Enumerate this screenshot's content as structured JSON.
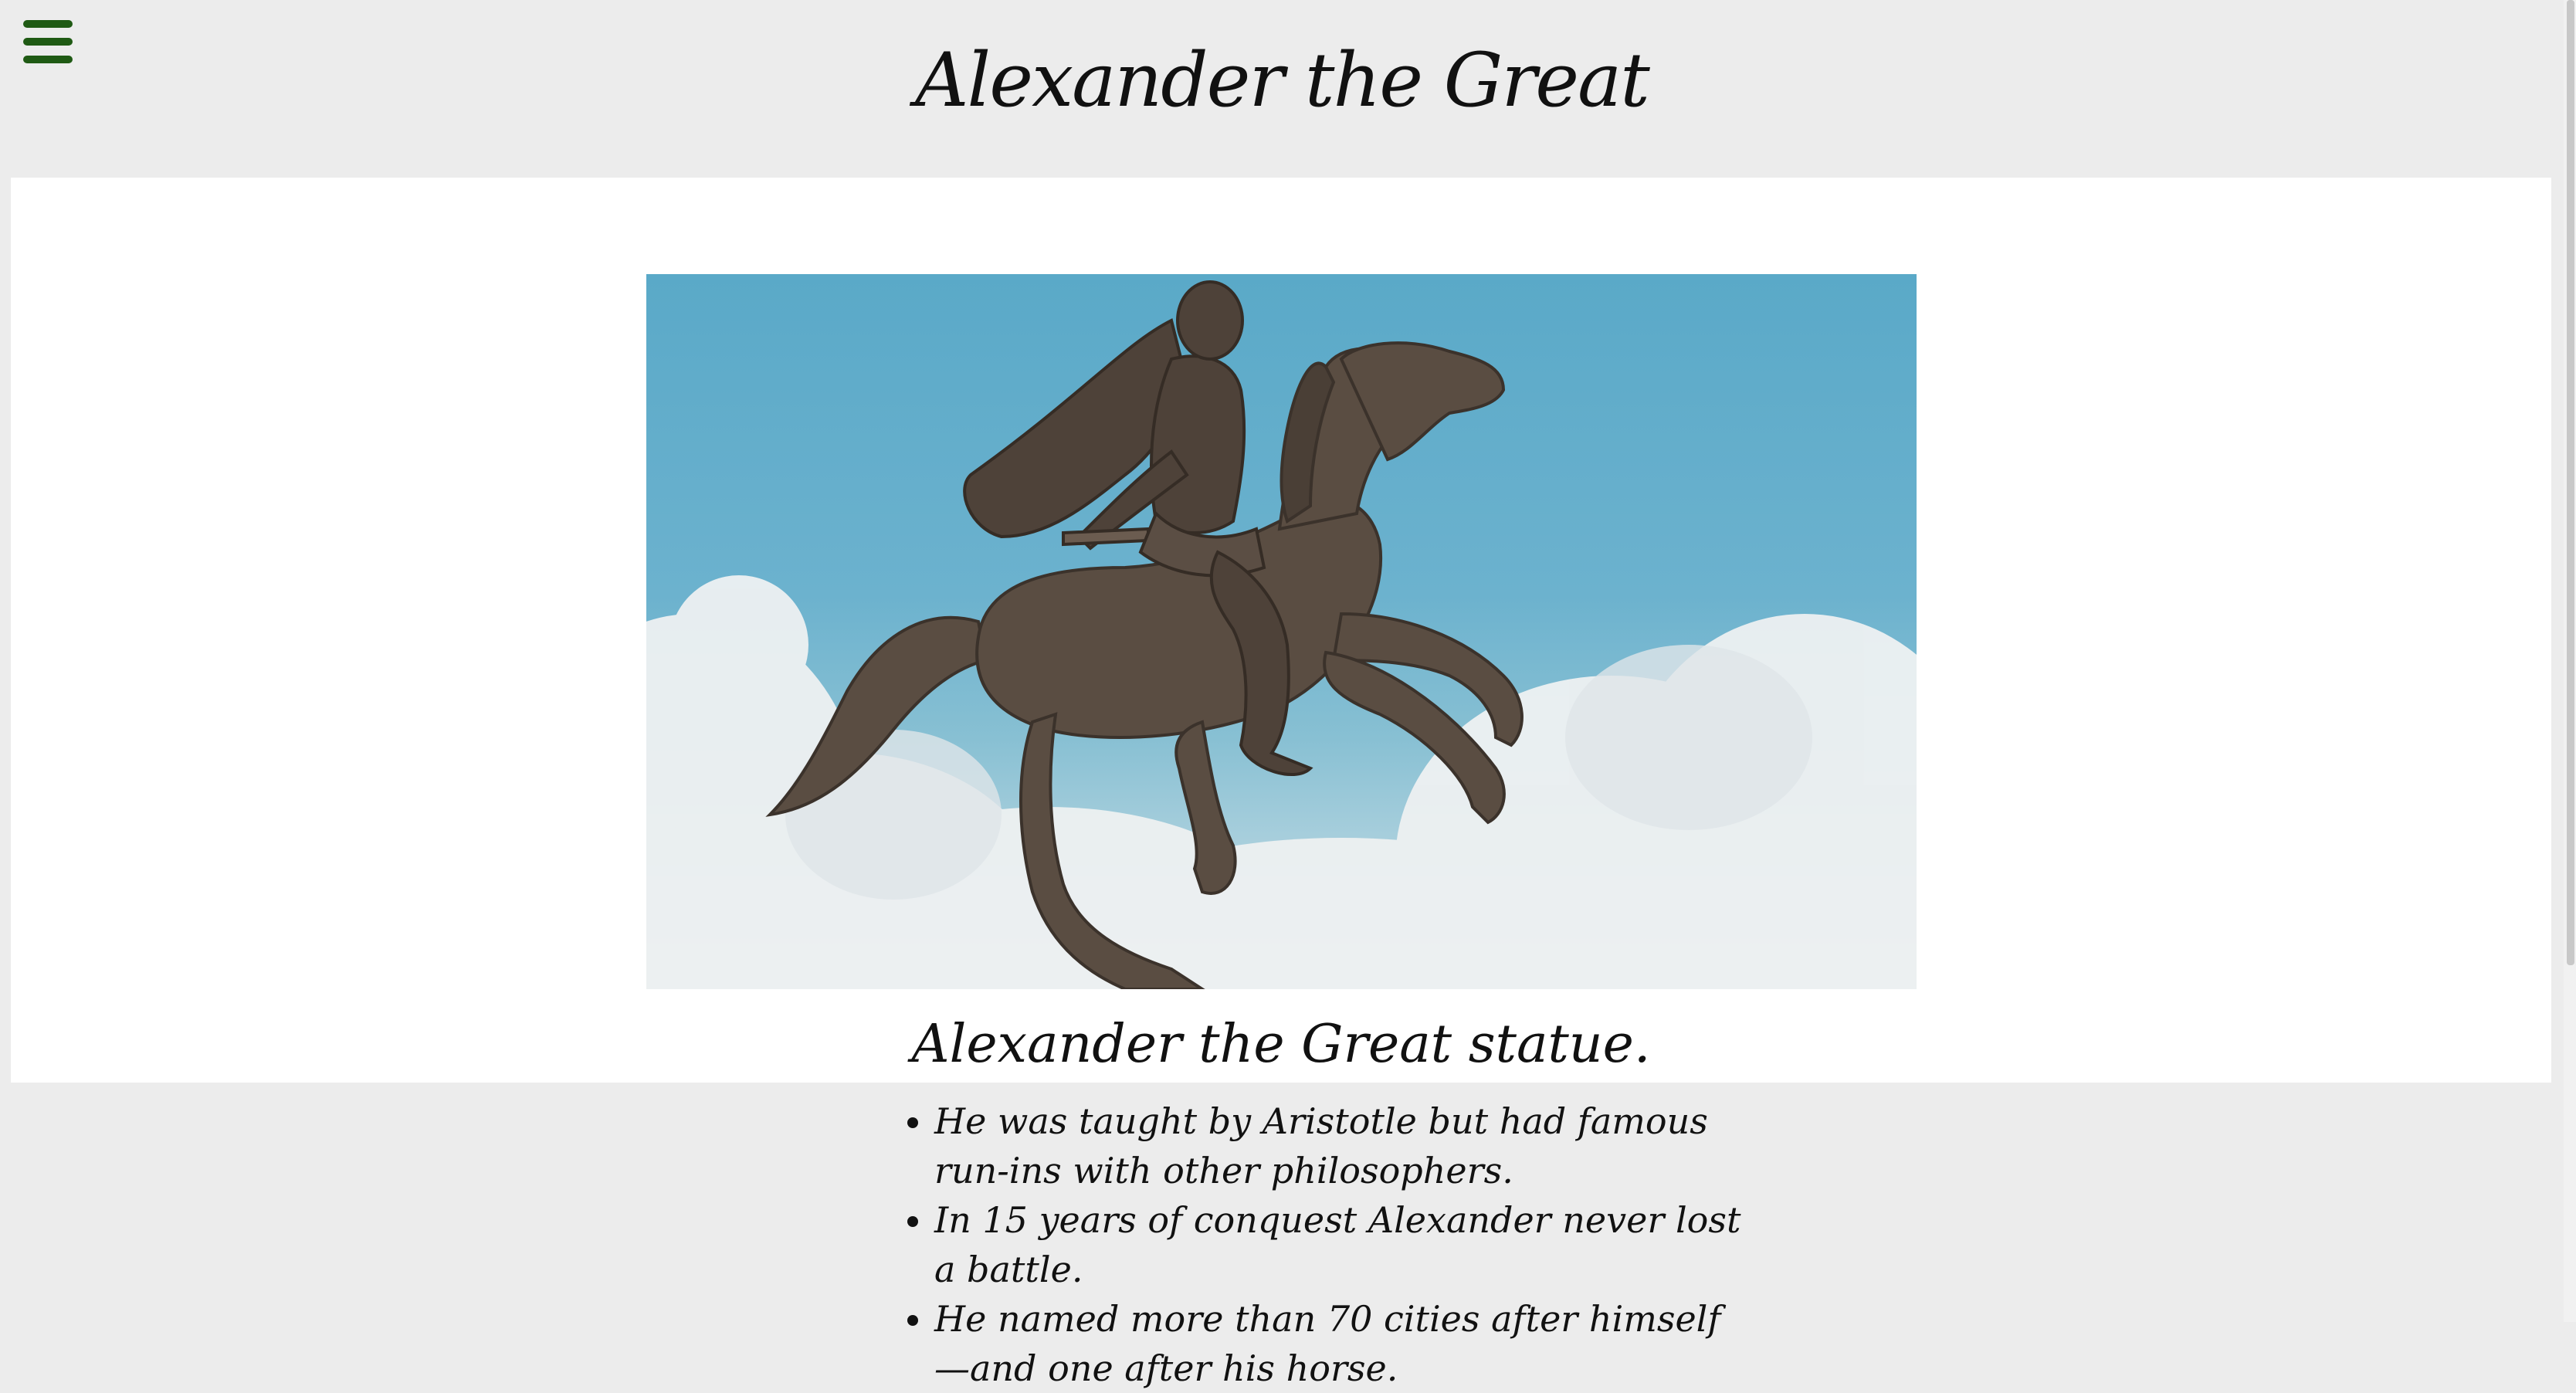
{
  "header": {
    "menu_icon": "hamburger-menu-icon",
    "menu_color": "#1f5a14",
    "title": "Alexander the Great"
  },
  "hero": {
    "image_subject": "Bronze equestrian statue of Alexander the Great on a rearing horse against blue sky and clouds",
    "caption": "Alexander the Great statue."
  },
  "facts": [
    "He was taught by Aristotle but had famous run-ins with other philosophers.",
    "In 15 years of conquest Alexander never lost a battle.",
    "He named more than 70 cities after himself—and one after his horse."
  ],
  "colors": {
    "page_background": "#ececec",
    "hero_background": "#ffffff",
    "text": "#111111"
  }
}
